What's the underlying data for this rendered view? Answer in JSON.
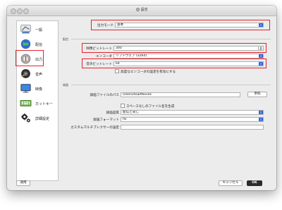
{
  "window": {
    "title": "設定"
  },
  "sidebar": {
    "items": [
      {
        "label": "一般",
        "icon": "general-settings-icon"
      },
      {
        "label": "配信",
        "icon": "stream-globe-icon"
      },
      {
        "label": "出力",
        "icon": "output-icon"
      },
      {
        "label": "音声",
        "icon": "audio-speaker-icon"
      },
      {
        "label": "映像",
        "icon": "video-monitor-icon"
      },
      {
        "label": "ホットキー",
        "icon": "keyboard-icon"
      },
      {
        "label": "詳細設定",
        "icon": "gears-icon"
      }
    ]
  },
  "output_mode": {
    "label": "出力モード",
    "value": "基本"
  },
  "streaming": {
    "section": "配信",
    "video_bitrate_label": "映像ビットレート",
    "video_bitrate": "300",
    "encoder_label": "エンコーダ",
    "encoder": "ソフトウェア (x264)",
    "audio_bitrate_label": "音声ビットレート",
    "audio_bitrate": "64",
    "advanced_encoder_checkbox": "高度なエンコーダの設定を有効にする"
  },
  "recording": {
    "section": "録画",
    "path_label": "録画ファイルのパス",
    "path": "/Users/toa/Movies",
    "browse_button": "参照",
    "no_space_checkbox": "スペースなしのファイル名を生成",
    "quality_label": "録画品質",
    "quality": "配信と同じ",
    "format_label": "録画フォーマット",
    "format": "flv",
    "muxer_label": "カスタムマルチプレクサーの設定",
    "muxer": ""
  },
  "buttons": {
    "apply": "適用",
    "cancel": "キャンセル",
    "ok": "OK"
  },
  "colors": {
    "highlight": "#e8212c",
    "accent": "#2a62d6"
  }
}
